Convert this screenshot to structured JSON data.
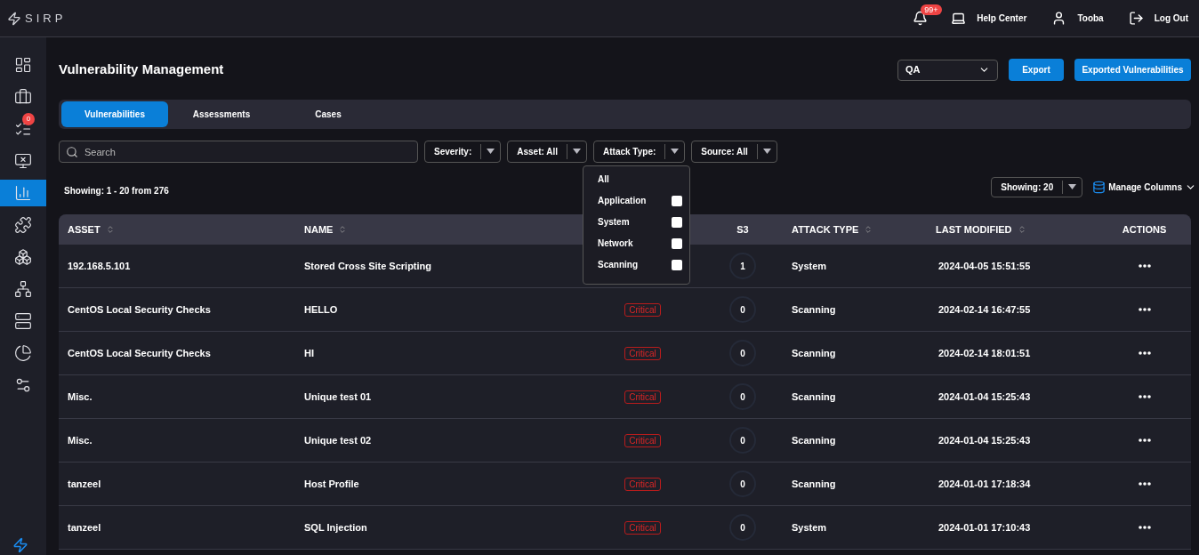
{
  "topbar": {
    "logo": "SIRP",
    "notifications": "99+",
    "help": "Help Center",
    "user": "Tooba",
    "logout": "Log Out"
  },
  "sidebar": {
    "items": [
      {
        "selected": false
      },
      {
        "selected": false
      },
      {
        "selected": false,
        "badge": "0"
      },
      {
        "selected": false
      },
      {
        "selected": true
      },
      {
        "selected": false
      },
      {
        "selected": false
      },
      {
        "selected": false
      },
      {
        "selected": false
      },
      {
        "selected": false
      },
      {
        "selected": false
      }
    ]
  },
  "page": {
    "title": "Vulnerability Management",
    "workspace": "QA",
    "buttons": [
      "Export",
      "Exported Vulnerabilities"
    ]
  },
  "tabs": [
    {
      "label": "Vulnerabilities",
      "selected": true
    },
    {
      "label": "Assessments",
      "selected": false
    },
    {
      "label": "Cases",
      "selected": false
    }
  ],
  "search": {
    "placeholder": "Search"
  },
  "filters": [
    "Severity:",
    "Asset: All",
    "Attack Type:",
    "Source: All"
  ],
  "attack_type_menu": {
    "all": "All",
    "options": [
      {
        "label": "Application",
        "checked": false
      },
      {
        "label": "System",
        "checked": false
      },
      {
        "label": "Network",
        "checked": false
      },
      {
        "label": "Scanning",
        "checked": false
      }
    ]
  },
  "showing": "Showing: 1 - 20 from 276",
  "page_size": "Showing: 20",
  "manage_columns": "Manage Columns",
  "table": {
    "columns": [
      {
        "label": "ASSET",
        "sortable": true
      },
      {
        "label": "NAME",
        "sortable": true
      },
      {
        "label": "S3",
        "sortable": false
      },
      {
        "label": "ATTACK TYPE",
        "sortable": true
      },
      {
        "label": "LAST MODIFIED",
        "sortable": true
      },
      {
        "label": "ACTIONS",
        "sortable": false
      }
    ],
    "rows": [
      {
        "asset": "192.168.5.101",
        "name": "Stored Cross Site Scripting",
        "s3": "1",
        "attack_type": "System",
        "modified": "2024-04-05 15:51:55"
      },
      {
        "asset": "CentOS Local Security Checks",
        "name": "HELLO",
        "severity": "Critical",
        "s3": "0",
        "attack_type": "Scanning",
        "modified": "2024-02-14 16:47:55"
      },
      {
        "asset": "CentOS Local Security Checks",
        "name": "HI",
        "severity": "Critical",
        "s3": "0",
        "attack_type": "Scanning",
        "modified": "2024-02-14 18:01:51"
      },
      {
        "asset": "Misc.",
        "name": "Unique test 01",
        "severity": "Critical",
        "s3": "0",
        "attack_type": "Scanning",
        "modified": "2024-01-04 15:25:43"
      },
      {
        "asset": "Misc.",
        "name": "Unique test 02",
        "severity": "Critical",
        "s3": "0",
        "attack_type": "Scanning",
        "modified": "2024-01-04 15:25:43"
      },
      {
        "asset": "tanzeel",
        "name": "Host Profile",
        "severity": "Critical",
        "s3": "0",
        "attack_type": "Scanning",
        "modified": "2024-01-01 17:18:34"
      },
      {
        "asset": "tanzeel",
        "name": "SQL Injection",
        "severity": "Critical",
        "s3": "0",
        "attack_type": "System",
        "modified": "2024-01-01 17:10:43"
      }
    ]
  }
}
